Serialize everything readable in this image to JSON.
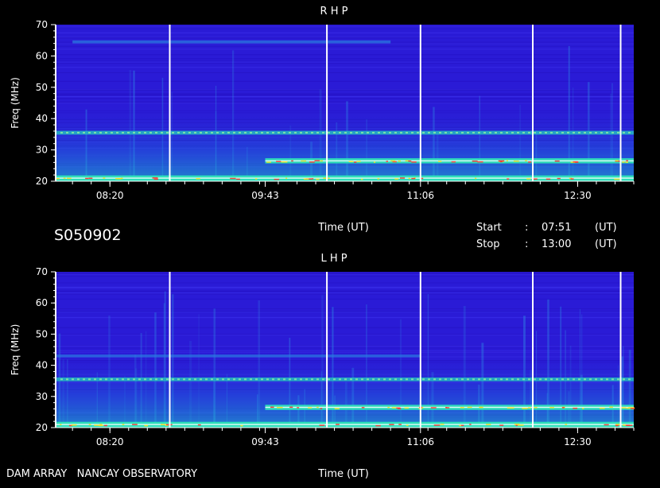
{
  "page": {
    "id_label": "S050902",
    "footer_left": "DAM ARRAY   NANCAY OBSERVATORY",
    "start_label": "Start",
    "start_time": "07:51",
    "stop_label": "Stop",
    "stop_time": "13:00",
    "colon": ":",
    "unit": "(UT)"
  },
  "colors": {
    "background": "#000000",
    "spectrum_base": "#2a1bd6",
    "axis": "#ffffff"
  },
  "chart_data": [
    {
      "type": "heatmap",
      "title": "R H P",
      "xlabel": "Time (UT)",
      "ylabel": "Freq (MHz)",
      "xlim": [
        "07:51",
        "13:00"
      ],
      "ylim": [
        20,
        70
      ],
      "x_ticks": [
        "08:20",
        "09:43",
        "11:06",
        "12:30"
      ],
      "y_ticks": [
        20,
        30,
        40,
        50,
        60,
        70
      ],
      "vertical_markers": [
        "08:52",
        "10:16",
        "11:06",
        "12:06",
        "12:53"
      ],
      "bands": [
        {
          "freq_mhz": 21,
          "t_start": "07:51",
          "t_end": "13:00",
          "intensity": 0.95
        },
        {
          "freq_mhz": 26.5,
          "t_start": "09:43",
          "t_end": "13:00",
          "intensity": 0.9
        },
        {
          "freq_mhz": 35.5,
          "t_start": "07:51",
          "t_end": "13:00",
          "intensity": 0.55
        },
        {
          "freq_mhz": 64.5,
          "t_start": "08:00",
          "t_end": "10:50",
          "intensity": 0.35
        }
      ]
    },
    {
      "type": "heatmap",
      "title": "L H P",
      "xlabel": "Time (UT)",
      "ylabel": "Freq (MHz)",
      "xlim": [
        "07:51",
        "13:00"
      ],
      "ylim": [
        20,
        70
      ],
      "x_ticks": [
        "08:20",
        "09:43",
        "11:06",
        "12:30"
      ],
      "y_ticks": [
        20,
        30,
        40,
        50,
        60,
        70
      ],
      "vertical_markers": [
        "08:52",
        "10:16",
        "11:06",
        "12:06",
        "12:53"
      ],
      "bands": [
        {
          "freq_mhz": 21,
          "t_start": "07:51",
          "t_end": "13:00",
          "intensity": 0.95
        },
        {
          "freq_mhz": 26.5,
          "t_start": "09:43",
          "t_end": "13:00",
          "intensity": 0.9
        },
        {
          "freq_mhz": 35.5,
          "t_start": "07:51",
          "t_end": "13:00",
          "intensity": 0.55
        },
        {
          "freq_mhz": 43,
          "t_start": "07:51",
          "t_end": "11:06",
          "intensity": 0.3
        }
      ]
    }
  ]
}
